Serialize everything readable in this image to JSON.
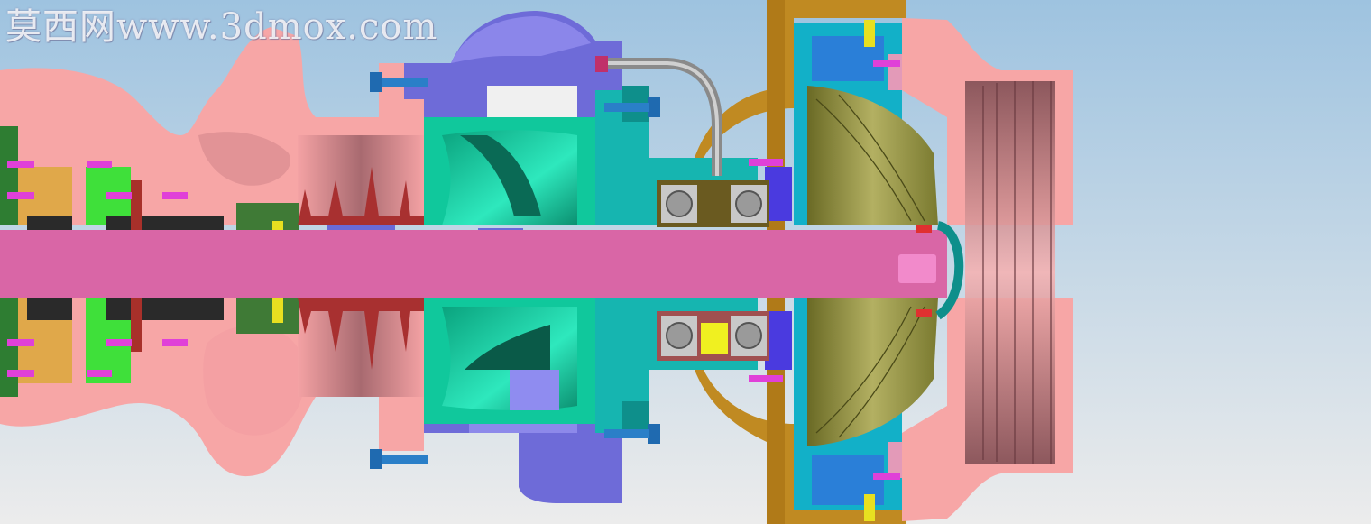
{
  "watermark": {
    "text": "莫西网www.3dmox.com"
  },
  "colors": {
    "background_top": "#9ec3e0",
    "background_bottom": "#ececec",
    "housing": "#f7a6a6",
    "housing_shadow": "#c97d82",
    "shaft": "#d966a6",
    "volute": "#6e6bd8",
    "impeller_cold": "#12d9a8",
    "impeller_hot": "#8a8a3a",
    "bearing_body": "#16b5b0",
    "turbine_casing": "#c08a22",
    "oil_pipe": "#a9a9a9",
    "bolt": "#1f6ab0",
    "fastener": "#e040d8",
    "seal_yellow": "#e8e020",
    "gear_green": "#2e7d32"
  },
  "icons": [
    "bolt-icon",
    "bearing-icon",
    "fastener-icon"
  ]
}
